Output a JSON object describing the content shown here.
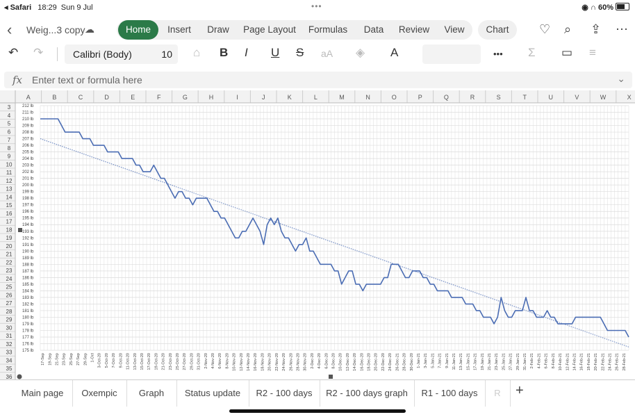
{
  "status": {
    "left_app": "◂ Safari",
    "time": "18:29",
    "date": "Sun 9 Jul",
    "dots": "•••",
    "right": "60%"
  },
  "ribbon": {
    "doc_name": "Weig...3 copy",
    "tabs": [
      {
        "label": "Home",
        "active": true
      },
      {
        "label": "Insert"
      },
      {
        "label": "Draw"
      },
      {
        "label": "Page Layout"
      },
      {
        "label": "Formulas"
      },
      {
        "label": "Data"
      },
      {
        "label": "Review"
      },
      {
        "label": "View"
      }
    ],
    "chart_tab": "Chart"
  },
  "toolbar": {
    "font": "Calibri (Body)",
    "size": "10",
    "bold": "B",
    "italic": "I",
    "underline": "U",
    "strike": "S",
    "font_size_grow": "aA",
    "more": "•••",
    "sum": "Σ"
  },
  "formula_bar": {
    "fx": "fx",
    "placeholder": "Enter text or formula here"
  },
  "columns": [
    "A",
    "B",
    "C",
    "D",
    "E",
    "F",
    "G",
    "H",
    "I",
    "J",
    "K",
    "L",
    "M",
    "N",
    "O",
    "P",
    "Q",
    "R",
    "S",
    "T",
    "U",
    "V",
    "W",
    "X"
  ],
  "rows": [
    "3",
    "4",
    "5",
    "6",
    "7",
    "8",
    "9",
    "10",
    "11",
    "12",
    "13",
    "14",
    "15",
    "16",
    "17",
    "18",
    "19",
    "20",
    "21",
    "22",
    "23",
    "24",
    "25",
    "26",
    "27",
    "28",
    "29",
    "30",
    "31",
    "32",
    "33",
    "34",
    "35",
    "36"
  ],
  "sheet_tabs": [
    "Main page",
    "Oxempic",
    "Graph",
    "Status update",
    "R2 - 100 days",
    "R2 - 100 days graph",
    "R1 - 100 days",
    "R"
  ],
  "chart_data": {
    "type": "line",
    "ylim": [
      175,
      212
    ],
    "y_tick_labels": [
      "212 lb",
      "211 lb",
      "210 lb",
      "209 lb",
      "208 lb",
      "207 lb",
      "206 lb",
      "205 lb",
      "204 lb",
      "203 lb",
      "202 lb",
      "201 lb",
      "200 lb",
      "199 lb",
      "198 lb",
      "197 lb",
      "196 lb",
      "195 lb",
      "194 lb",
      "193 lb",
      "192 lb",
      "191 lb",
      "190 lb",
      "189 lb",
      "188 lb",
      "187 lb",
      "186 lb",
      "185 lb",
      "184 lb",
      "183 lb",
      "182 lb",
      "181 lb",
      "180 lb",
      "179 lb",
      "178 lb",
      "177 lb",
      "176 lb",
      "175 lb"
    ],
    "x_tick_labels": [
      "17-Sep",
      "19-Sep",
      "21-Sep",
      "23-Sep",
      "25-Sep",
      "27-Sep",
      "29-Sep",
      "1-Oct",
      "3-Oct-20",
      "5-Oct-20",
      "7-Oct-20",
      "9-Oct-20",
      "11-Oct-20",
      "13-Oct-20",
      "15-Oct-20",
      "17-Oct-20",
      "19-Oct-20",
      "21-Oct-20",
      "23-Oct-20",
      "25-Oct-20",
      "27-Oct-20",
      "29-Oct-20",
      "31-Oct-20",
      "2-Nov-20",
      "4-Nov-20",
      "6-Nov-20",
      "8-Nov-20",
      "10-Nov-20",
      "12-Nov-20",
      "14-Nov-20",
      "16-Nov-20",
      "18-Nov-20",
      "20-Nov-20",
      "22-Nov-20",
      "24-Nov-20",
      "26-Nov-20",
      "28-Nov-20",
      "30-Nov-20",
      "2-Dec-20",
      "4-Dec-20",
      "6-Dec-20",
      "8-Dec-20",
      "10-Dec-20",
      "12-Dec-20",
      "14-Dec-20",
      "16-Dec-20",
      "18-Dec-20",
      "20-Dec-20",
      "22-Dec-20",
      "24-Dec-20",
      "26-Dec-21",
      "28-Dec-20",
      "30-Dec-20",
      "1-Jan-21",
      "3-Jan-21",
      "5-Jan-21",
      "7-Jan-21",
      "9-Jan-21",
      "11-Jan-21",
      "13-Jan-21",
      "15-Jan-21",
      "17-Jan-21",
      "19-Jan-21",
      "21-Jan-21",
      "23-Jan-21",
      "25-Jan-21",
      "27-Jan-21",
      "29-Jan-21",
      "31-Jan-21",
      "2-Feb-21",
      "4-Feb-21",
      "6-Feb-21",
      "8-Feb-21",
      "10-Feb-21",
      "12-Feb-21",
      "14-Feb-21",
      "16-Feb-21",
      "18-Feb-21",
      "20-Feb-21",
      "22-Feb-21",
      "24-Feb-21",
      "26-Feb-21",
      "28-Feb-21"
    ],
    "series": [
      {
        "color": "#4a6cb3",
        "values": [
          210,
          210,
          210,
          210,
          210,
          210,
          209,
          208,
          208,
          208,
          208,
          208,
          207,
          207,
          207,
          206,
          206,
          206,
          206,
          205,
          205,
          205,
          205,
          204,
          204,
          204,
          204,
          203,
          203,
          202,
          202,
          202,
          203,
          202,
          201,
          201,
          200,
          199,
          198,
          199,
          199,
          198,
          198,
          197,
          198,
          198,
          198,
          198,
          197,
          196,
          196,
          195,
          195,
          194,
          193,
          192,
          192,
          193,
          193,
          194,
          195,
          194,
          193,
          191,
          194,
          195,
          194,
          195,
          193,
          192,
          192,
          191,
          190,
          191,
          191,
          192,
          190,
          190,
          189,
          188,
          188,
          188,
          188,
          187,
          187,
          185,
          186,
          187,
          187,
          185,
          185,
          184,
          185,
          185,
          185,
          185,
          185,
          186,
          186,
          188,
          188,
          188,
          187,
          186,
          186,
          187,
          187,
          187,
          186,
          186,
          185,
          185,
          184,
          184,
          184,
          184,
          183,
          183,
          183,
          183,
          182,
          182,
          182,
          181,
          181,
          180,
          180,
          180,
          179,
          180,
          183,
          181,
          180,
          180,
          181,
          181,
          181,
          183,
          181,
          181,
          180,
          180,
          180,
          181,
          180,
          180,
          179,
          179,
          179,
          179,
          179,
          180,
          180,
          180,
          180,
          180,
          180,
          180,
          180,
          179,
          178,
          178,
          178,
          178,
          178,
          178,
          177
        ]
      }
    ],
    "trendline": {
      "style": "dotted",
      "color": "#4a6cb3",
      "start": 207,
      "end": 175.5
    },
    "grid": true
  }
}
